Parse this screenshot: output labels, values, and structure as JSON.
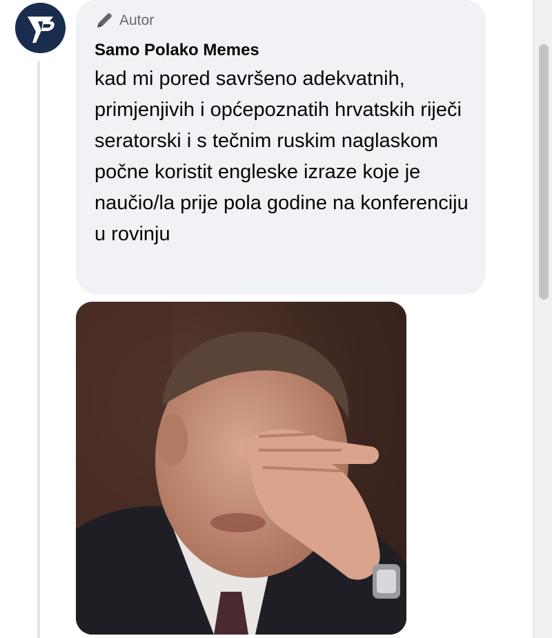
{
  "comment": {
    "badge_icon": "pen-icon",
    "badge_label": "Autor",
    "author_name": "Samo Polako Memes",
    "text": "kad mi pored savršeno adekvatnih, primjenjivih i općepoznatih hrvatskih riječi seratorski i s tečnim ruskim naglaskom počne koristit engleske izraze koje je naučio/la prije pola godine na konferenciju u rovinju"
  },
  "avatar": {
    "icon": "samo-polako-logo",
    "background": "#1b2d4f"
  },
  "gif": {
    "icon": "facepalm-gif"
  },
  "colors": {
    "bubble_bg": "#f0f2f5",
    "text": "#050505",
    "muted": "#65676b"
  }
}
